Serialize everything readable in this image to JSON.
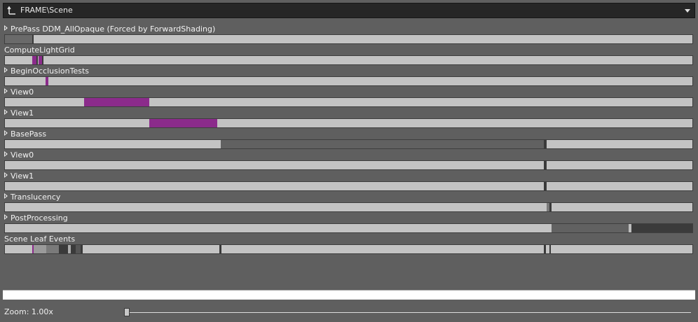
{
  "header": {
    "path": "FRAME\\Scene"
  },
  "events": [
    {
      "label": "PrePass DDM_AllOpaque (Forced by ForwardShading)",
      "expandable": true,
      "segments": [
        {
          "start": 0.0,
          "end": 0.04,
          "color": "#6a6a6a"
        },
        {
          "start": 0.04,
          "end": 0.042,
          "color": "#3a3a3a"
        }
      ]
    },
    {
      "label": "ComputeLightGrid",
      "expandable": false,
      "segments": [
        {
          "start": 0.04,
          "end": 0.046,
          "color": "#8b2b8b"
        },
        {
          "start": 0.046,
          "end": 0.048,
          "color": "#3a3a3a"
        },
        {
          "start": 0.049,
          "end": 0.054,
          "color": "#8b2b8b"
        },
        {
          "start": 0.054,
          "end": 0.056,
          "color": "#3a3a3a"
        }
      ]
    },
    {
      "label": "BeginOcclusionTests",
      "expandable": true,
      "segments": [
        {
          "start": 0.059,
          "end": 0.063,
          "color": "#8b2b8b"
        }
      ]
    },
    {
      "label": "View0",
      "expandable": true,
      "segments": [
        {
          "start": 0.115,
          "end": 0.21,
          "color": "#8b2b8b"
        }
      ]
    },
    {
      "label": "View1",
      "expandable": true,
      "segments": [
        {
          "start": 0.21,
          "end": 0.308,
          "color": "#8b2b8b"
        }
      ]
    },
    {
      "label": "BasePass",
      "expandable": true,
      "segments": [
        {
          "start": 0.313,
          "end": 0.782,
          "color": "#616161"
        },
        {
          "start": 0.782,
          "end": 0.786,
          "color": "#3a3a3a"
        }
      ]
    },
    {
      "label": "View0",
      "expandable": true,
      "segments": [
        {
          "start": 0.782,
          "end": 0.786,
          "color": "#3a3a3a"
        }
      ]
    },
    {
      "label": "View1",
      "expandable": true,
      "segments": [
        {
          "start": 0.782,
          "end": 0.786,
          "color": "#3a3a3a"
        }
      ]
    },
    {
      "label": "Translucency",
      "expandable": true,
      "segments": [
        {
          "start": 0.786,
          "end": 0.79,
          "color": "#7a7a7a"
        },
        {
          "start": 0.79,
          "end": 0.793,
          "color": "#3a3a3a"
        }
      ]
    },
    {
      "label": "PostProcessing",
      "expandable": true,
      "segments": [
        {
          "start": 0.793,
          "end": 0.905,
          "color": "#616161"
        },
        {
          "start": 0.905,
          "end": 0.909,
          "color": "#bdbdbd"
        },
        {
          "start": 0.909,
          "end": 1.0,
          "color": "#3b3b3b"
        }
      ]
    },
    {
      "label": "Scene Leaf Events",
      "expandable": false,
      "segments": [
        {
          "start": 0.04,
          "end": 0.042,
          "color": "#8b2b8b"
        },
        {
          "start": 0.042,
          "end": 0.06,
          "color": "#9a9a9a"
        },
        {
          "start": 0.06,
          "end": 0.078,
          "color": "#7a7a7a"
        },
        {
          "start": 0.078,
          "end": 0.092,
          "color": "#3a3a3a"
        },
        {
          "start": 0.092,
          "end": 0.096,
          "color": "#aaaaaa"
        },
        {
          "start": 0.096,
          "end": 0.103,
          "color": "#3a3a3a"
        },
        {
          "start": 0.103,
          "end": 0.11,
          "color": "#555555"
        },
        {
          "start": 0.11,
          "end": 0.113,
          "color": "#3a3a3a"
        },
        {
          "start": 0.311,
          "end": 0.314,
          "color": "#3a3a3a"
        },
        {
          "start": 0.782,
          "end": 0.785,
          "color": "#3a3a3a"
        },
        {
          "start": 0.79,
          "end": 0.792,
          "color": "#3a3a3a"
        }
      ]
    }
  ],
  "zoom": {
    "label": "Zoom: 1.00x",
    "level": 0.0
  },
  "icons": {
    "up": "folder-up-icon",
    "dropdown": "chevron-down-icon",
    "expand": "expand-triangle-icon"
  }
}
